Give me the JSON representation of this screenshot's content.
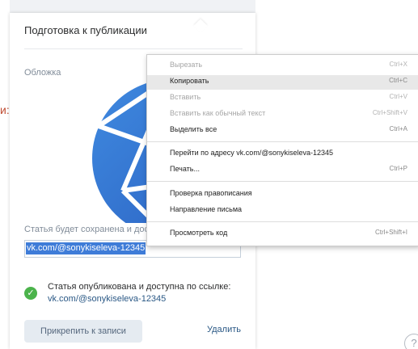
{
  "background": {
    "fragment": "и:",
    "help": "?"
  },
  "panel": {
    "title": "Подготовка к публикации",
    "cover_label": "Обложка",
    "save_text": "Статья будет сохранена и дос",
    "link_value": "vk.com/@sonykiseleva-12345",
    "success_icon": "✓",
    "success_line1": "Статья опубликована и доступна по ссылке:",
    "success_line2": "vk.com/@sonykiseleva-12345",
    "attach_button": "Прикрепить к записи",
    "delete_link": "Удалить"
  },
  "context_menu": {
    "items": [
      {
        "label": "Вырезать",
        "shortcut": "Ctrl+X",
        "disabled": true
      },
      {
        "label": "Копировать",
        "shortcut": "Ctrl+C",
        "highlighted": true
      },
      {
        "label": "Вставить",
        "shortcut": "Ctrl+V",
        "disabled": true
      },
      {
        "label": "Вставить как обычный текст",
        "shortcut": "Ctrl+Shift+V",
        "disabled": true
      },
      {
        "label": "Выделить все",
        "shortcut": "Ctrl+A"
      },
      {
        "label": "Перейти по адресу vk.com/@sonykiseleva-12345",
        "shortcut": ""
      },
      {
        "label": "Печать...",
        "shortcut": "Ctrl+P"
      },
      {
        "label": "Проверка правописания",
        "shortcut": ""
      },
      {
        "label": "Направление письма",
        "shortcut": ""
      },
      {
        "label": "Просмотреть код",
        "shortcut": "Ctrl+Shift+I"
      }
    ]
  },
  "colors": {
    "accent": "#2a5885",
    "success": "#4bb34b",
    "selection": "#3e7cd8"
  }
}
